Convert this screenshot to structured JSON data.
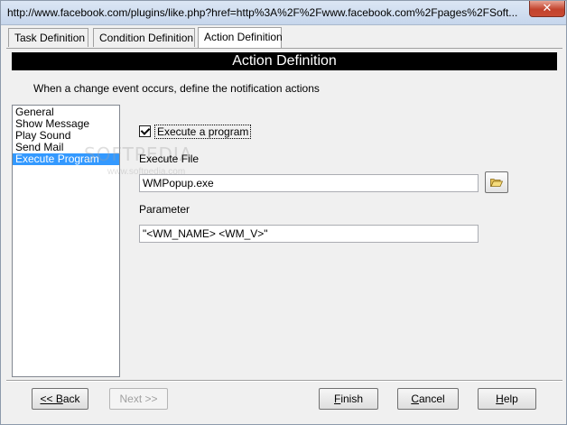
{
  "window": {
    "title": "http://www.facebook.com/plugins/like.php?href=http%3A%2F%2Fwww.facebook.com%2Fpages%2FSoft...",
    "close_glyph": "✕"
  },
  "tabs": [
    {
      "label": "Task Definition",
      "active": false
    },
    {
      "label": "Condition Definition",
      "active": false
    },
    {
      "label": "Action Definition",
      "active": true
    }
  ],
  "header": {
    "title": "Action Definition"
  },
  "instruction": "When a change event occurs, define the notification actions",
  "action_list": {
    "items": [
      "General",
      "Show Message",
      "Play Sound",
      "Send Mail",
      "Execute Program"
    ],
    "selected": "Execute Program"
  },
  "execute": {
    "checkbox_label": "Execute a program",
    "checked": true,
    "file_label": "Execute File",
    "file_value": "WMPopup.exe",
    "param_label": "Parameter",
    "param_value": "\"<WM_NAME> <WM_V>\""
  },
  "watermark": {
    "text": "SOFTPEDIA",
    "url": "www.softpedia.com"
  },
  "buttons": {
    "back": {
      "ul": "<< B",
      "rest": "ack"
    },
    "next": {
      "label": "Next >>"
    },
    "finish": {
      "ul": "F",
      "rest": "inish"
    },
    "cancel": {
      "ul": "C",
      "rest": "ancel"
    },
    "help": {
      "ul": "H",
      "rest": "elp"
    }
  },
  "icons": {
    "browse": "folder-open-icon",
    "close": "close-icon"
  },
  "colors": {
    "selection": "#3399ff",
    "header_band": "#000000",
    "close_button": "#c3432d"
  }
}
